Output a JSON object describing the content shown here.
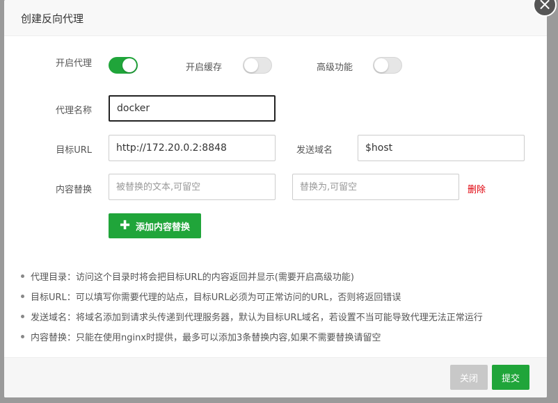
{
  "dialog": {
    "title": "创建反向代理",
    "close_icon": "×"
  },
  "form": {
    "proxy_enable": {
      "label": "开启代理",
      "on": true
    },
    "cache_enable": {
      "label": "开启缓存",
      "on": false
    },
    "advanced": {
      "label": "高级功能",
      "on": false
    },
    "proxy_name": {
      "label": "代理名称",
      "value": "docker"
    },
    "target_url": {
      "label": "目标URL",
      "value": "http://172.20.0.2:8848"
    },
    "send_domain": {
      "label": "发送域名",
      "value": "$host"
    },
    "content_replace": {
      "label": "内容替换",
      "from_placeholder": "被替换的文本,可留空",
      "to_placeholder": "替换为,可留空",
      "delete_label": "删除"
    },
    "add_replace_label": "添加内容替换"
  },
  "tips": [
    "代理目录：访问这个目录时将会把目标URL的内容返回并显示(需要开启高级功能)",
    "目标URL：可以填写你需要代理的站点，目标URL必须为可正常访问的URL，否则将返回错误",
    "发送域名：将域名添加到请求头传递到代理服务器，默认为目标URL域名，若设置不当可能导致代理无法正常运行",
    "内容替换：只能在使用nginx时提供，最多可以添加3条替换内容,如果不需要替换请留空"
  ],
  "footer": {
    "close_label": "关闭",
    "submit_label": "提交"
  },
  "colors": {
    "accent": "#20a53a",
    "danger": "#e0000a"
  }
}
